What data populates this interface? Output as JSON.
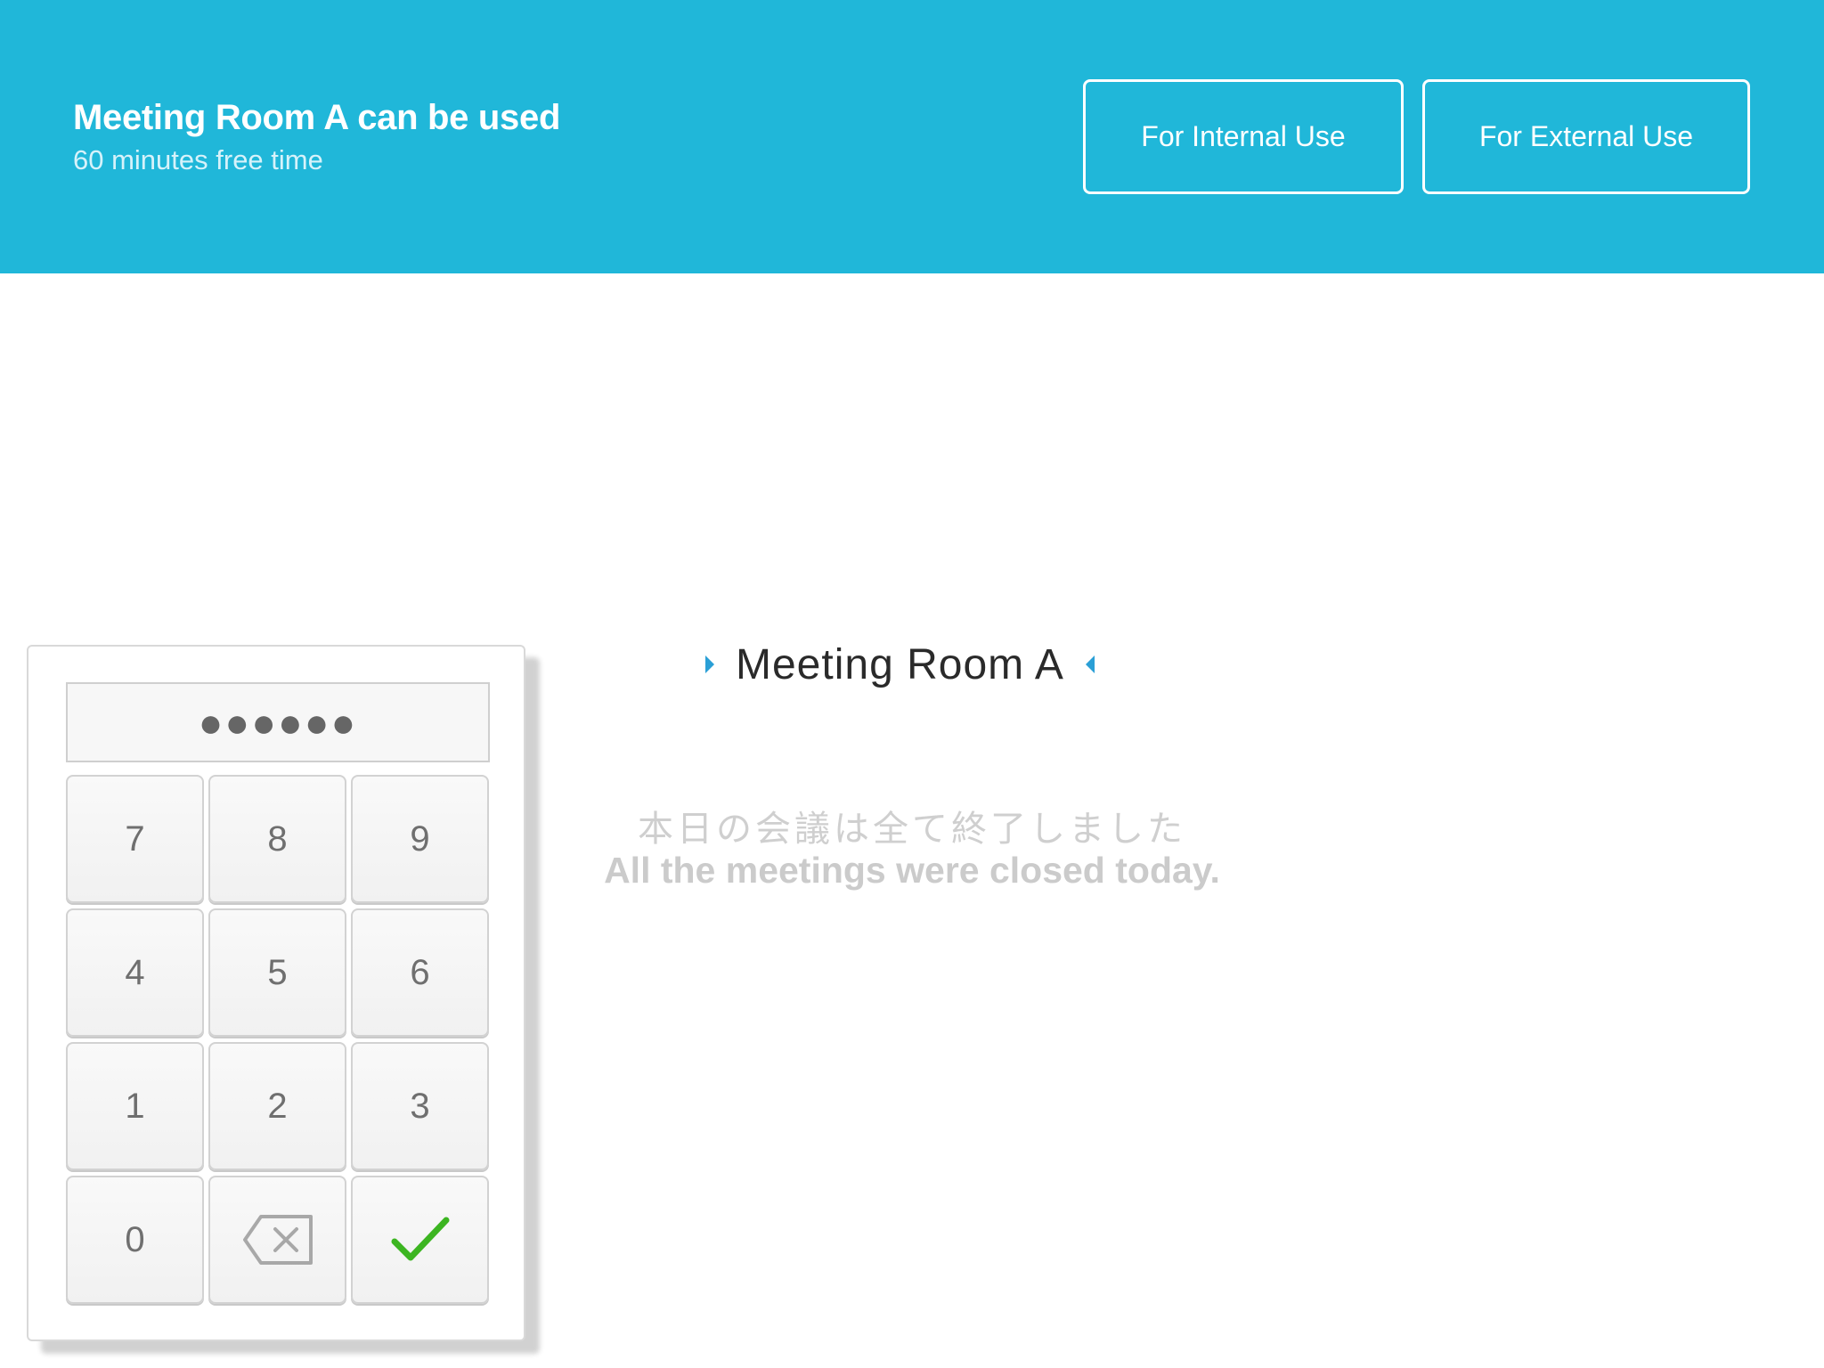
{
  "header": {
    "title": "Meeting Room A can be used",
    "subtitle": "60 minutes free time",
    "internal_button": "For Internal Use",
    "external_button": "For External Use"
  },
  "keypad": {
    "pin_masked": "●●●●●●",
    "keys": [
      "7",
      "8",
      "9",
      "4",
      "5",
      "6",
      "1",
      "2",
      "3",
      "0"
    ],
    "backspace_icon": "backspace-icon",
    "confirm_icon": "checkmark-icon"
  },
  "room": {
    "name": "Meeting Room A"
  },
  "status": {
    "message_jp": "本日の会議は全て終了しました",
    "message_en": "All the meetings were closed today."
  },
  "colors": {
    "header_bg": "#20b7d9",
    "accent": "#2a9fd6",
    "confirm": "#3cb521"
  }
}
